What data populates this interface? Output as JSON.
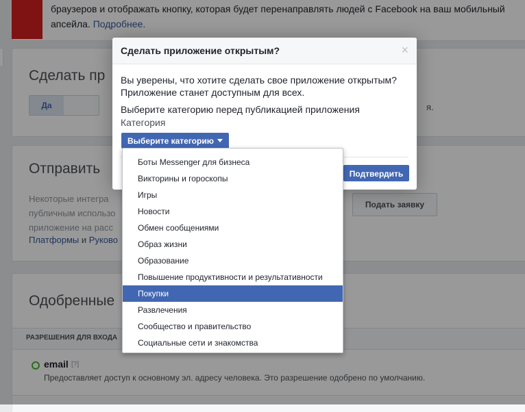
{
  "page": {
    "top_notice": {
      "line1": "браузеров и отображать кнопку, которая будет перенаправлять людей с Facebook на ваш мобильный",
      "line2_prefix": "апсейла.",
      "more_link": "Подробнее."
    },
    "publish_section": {
      "title": "Сделать пр",
      "toggle_yes": "Да",
      "side_text": "я."
    },
    "submit_section": {
      "title": "Отправить",
      "desc": "Некоторые интегра публичным использо приложение на расс",
      "link1": "Платформы",
      "and": "и",
      "link2": "Руково",
      "submit_button": "Подать заявку"
    },
    "approved_section": {
      "title": "Одобренные",
      "table_header": "РАЗРЕШЕНИЯ ДЛЯ ВХОДА",
      "permission_name": "email",
      "permission_help": "[?]",
      "permission_desc": "Предоставляет доступ к основному эл. адресу человека. Это разрешение одобрено по умолчанию."
    }
  },
  "dialog": {
    "title": "Сделать приложение открытым?",
    "close_glyph": "×",
    "message": "Вы уверены, что хотите сделать свое приложение открытым? Приложение станет доступным для всех.",
    "category_prompt": "Выберите категорию перед публикацией приложения",
    "category_label": "Категория",
    "category_button": "Выберите категорию",
    "confirm_button": "Подтвердить"
  },
  "category_menu": {
    "items": [
      "Боты Messenger для бизнеса",
      "Викторины и гороскопы",
      "Игры",
      "Новости",
      "Обмен сообщениями",
      "Образ жизни",
      "Образование",
      "Повышение продуктивности и результативности",
      "Покупки",
      "Развлечения",
      "Сообщество и правительство",
      "Социальные сети и знакомства"
    ],
    "highlighted": "Покупки"
  },
  "colors": {
    "accent": "#4267b2",
    "link": "#365899",
    "red_block": "#d42020",
    "success": "#42b72a"
  }
}
